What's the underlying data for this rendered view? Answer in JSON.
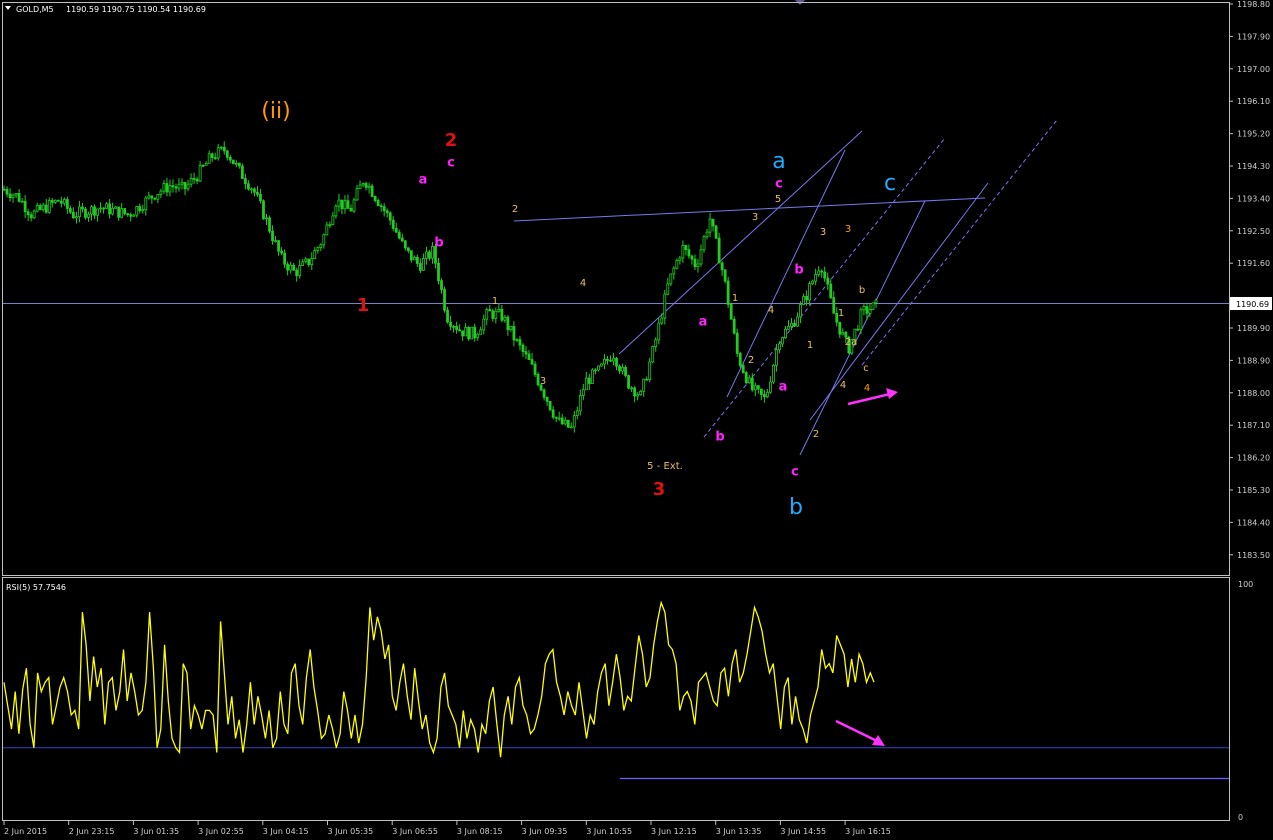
{
  "header": {
    "symbol": "GOLD,M5",
    "ohlc": "1190.59 1190.75 1190.54 1190.69",
    "rsi_label": "RSI(5) 57.7546"
  },
  "colors": {
    "background": "#000000",
    "grid_border": "#c0c0c0",
    "candle": "#22cc22",
    "trendline": "#7777ee",
    "rsi_line": "#ffff00",
    "arrow": "#ff33ff"
  },
  "price_axis": {
    "labels": [
      "1198.80",
      "1197.90",
      "1197.00",
      "1196.10",
      "1195.20",
      "1194.30",
      "1193.40",
      "1192.50",
      "1191.60",
      "1190.69",
      "1189.90",
      "1188.90",
      "1188.00",
      "1187.10",
      "1186.20",
      "1185.30",
      "1184.40",
      "1183.50"
    ],
    "current": "1190.69"
  },
  "rsi_axis": {
    "top": "100",
    "bottom": "0",
    "level": 30
  },
  "time_axis": [
    "2 Jun 2015",
    "2 Jun 23:15",
    "3 Jun 01:35",
    "3 Jun 02:55",
    "3 Jun 04:15",
    "3 Jun 05:35",
    "3 Jun 06:55",
    "3 Jun 08:15",
    "3 Jun 09:35",
    "3 Jun 10:55",
    "3 Jun 12:15",
    "3 Jun 13:35",
    "3 Jun 14:55",
    "3 Jun 16:15"
  ],
  "wave_labels": [
    {
      "text": "(ii)",
      "color": "#ff9900",
      "size": "xl"
    },
    {
      "text": "1",
      "color": "#dd1111",
      "size": "l"
    },
    {
      "text": "2",
      "color": "#dd1111",
      "size": "l"
    },
    {
      "text": "a",
      "color": "#ff22ff",
      "size": "s"
    },
    {
      "text": "b",
      "color": "#ff22ff",
      "size": "s"
    },
    {
      "text": "c",
      "color": "#ff22ff",
      "size": "s"
    },
    {
      "text": "2",
      "color": "#e8c060",
      "size": "xs"
    },
    {
      "text": "1",
      "color": "#e8c060",
      "size": "xs"
    },
    {
      "text": "3",
      "color": "#e8c060",
      "size": "xs"
    },
    {
      "text": "4",
      "color": "#e8c060",
      "size": "xs"
    },
    {
      "text": "5 - Ext.",
      "color": "#e8c060",
      "size": "xs"
    },
    {
      "text": "3",
      "color": "#dd1111",
      "size": "l"
    },
    {
      "text": "a",
      "color": "#ff22ff",
      "size": "s"
    },
    {
      "text": "b",
      "color": "#ff22ff",
      "size": "s"
    },
    {
      "text": "1",
      "color": "#e8c060",
      "size": "xs"
    },
    {
      "text": "2",
      "color": "#e8c060",
      "size": "xs"
    },
    {
      "text": "3",
      "color": "#e8c060",
      "size": "xs"
    },
    {
      "text": "4",
      "color": "#e8c060",
      "size": "xs"
    },
    {
      "text": "5",
      "color": "#e8c060",
      "size": "xs"
    },
    {
      "text": "c",
      "color": "#ff22ff",
      "size": "s"
    },
    {
      "text": "a",
      "color": "#22aaff",
      "size": "xl"
    },
    {
      "text": "b",
      "color": "#ff22ff",
      "size": "s"
    },
    {
      "text": "a",
      "color": "#ff22ff",
      "size": "s"
    },
    {
      "text": "c",
      "color": "#ff22ff",
      "size": "s"
    },
    {
      "text": "b",
      "color": "#22aaff",
      "size": "xl"
    },
    {
      "text": "1",
      "color": "#e8c060",
      "size": "xs"
    },
    {
      "text": "2",
      "color": "#e8c060",
      "size": "xs"
    },
    {
      "text": "3",
      "color": "#e8c060",
      "size": "xs"
    },
    {
      "text": "4",
      "color": "#e8c060",
      "size": "xs"
    },
    {
      "text": "3",
      "color": "#ff9900",
      "size": "xs"
    },
    {
      "text": "1",
      "color": "#e8c060",
      "size": "xs"
    },
    {
      "text": "2a",
      "color": "#e8c060",
      "size": "xs"
    },
    {
      "text": "b",
      "color": "#e8c060",
      "size": "xs"
    },
    {
      "text": "c",
      "color": "#e8c060",
      "size": "xs"
    },
    {
      "text": "4",
      "color": "#ff9900",
      "size": "xs"
    },
    {
      "text": "c",
      "color": "#22aaff",
      "size": "xl"
    }
  ],
  "chart_data": [
    {
      "type": "candlestick",
      "title": "GOLD,M5",
      "ylim": [
        1183.3,
        1199.0
      ],
      "x": [
        "2 Jun 2015",
        "2 Jun 23:15",
        "3 Jun 01:35",
        "3 Jun 02:55",
        "3 Jun 04:15",
        "3 Jun 05:35",
        "3 Jun 06:55",
        "3 Jun 08:15",
        "3 Jun 09:35",
        "3 Jun 10:55",
        "3 Jun 12:15",
        "3 Jun 13:35",
        "3 Jun 14:55",
        "3 Jun 16:15"
      ],
      "close_path": [
        1193.9,
        1193.7,
        1193.2,
        1193.4,
        1193.6,
        1193.2,
        1193.3,
        1193.4,
        1193.3,
        1193.2,
        1193.5,
        1193.8,
        1194.0,
        1193.9,
        1194.3,
        1194.8,
        1195.0,
        1194.4,
        1193.9,
        1193.0,
        1192.0,
        1191.6,
        1191.9,
        1192.5,
        1193.6,
        1193.3,
        1194.2,
        1193.6,
        1193.0,
        1192.2,
        1191.8,
        1192.2,
        1190.4,
        1190.0,
        1189.9,
        1190.5,
        1190.4,
        1189.7,
        1189.1,
        1188.3,
        1187.5,
        1187.3,
        1188.6,
        1188.9,
        1189.4,
        1188.6,
        1188.2,
        1189.6,
        1191.3,
        1192.3,
        1191.8,
        1193.1,
        1191.5,
        1189.3,
        1188.4,
        1188.1,
        1189.8,
        1190.2,
        1191.0,
        1191.9,
        1190.4,
        1189.5,
        1190.5,
        1190.69
      ],
      "current": 1190.69,
      "trendlines": [
        {
          "from": [
            514,
            221
          ],
          "to": [
            985,
            198
          ],
          "style": "solid"
        },
        {
          "from": [
            619,
            354
          ],
          "to": [
            862,
            131
          ],
          "style": "solid"
        },
        {
          "from": [
            704,
            437
          ],
          "to": [
            945,
            138
          ],
          "style": "dashed"
        },
        {
          "from": [
            727,
            397
          ],
          "to": [
            845,
            150
          ],
          "style": "solid"
        },
        {
          "from": [
            800,
            455
          ],
          "to": [
            925,
            201
          ],
          "style": "solid"
        },
        {
          "from": [
            810,
            420
          ],
          "to": [
            988,
            183
          ],
          "style": "solid"
        },
        {
          "from": [
            862,
            365
          ],
          "to": [
            1057,
            120
          ],
          "style": "dashed"
        }
      ]
    },
    {
      "type": "line",
      "title": "RSI(5) 57.7546",
      "ylim": [
        0,
        100
      ],
      "level": 30,
      "values": [
        58,
        48,
        38,
        54,
        36,
        55,
        64,
        40,
        30,
        62,
        54,
        58,
        60,
        40,
        48,
        56,
        60,
        54,
        44,
        46,
        38,
        88,
        74,
        50,
        69,
        56,
        64,
        40,
        58,
        60,
        46,
        54,
        72,
        50,
        62,
        54,
        44,
        46,
        58,
        88,
        64,
        30,
        38,
        74,
        50,
        34,
        30,
        28,
        66,
        62,
        38,
        48,
        44,
        38,
        46,
        46,
        44,
        28,
        84,
        62,
        40,
        52,
        34,
        42,
        28,
        40,
        58,
        40,
        52,
        44,
        34,
        46,
        30,
        34,
        54,
        40,
        36,
        62,
        66,
        48,
        40,
        60,
        72,
        56,
        46,
        34,
        36,
        44,
        38,
        30,
        36,
        54,
        46,
        34,
        44,
        32,
        40,
        60,
        90,
        76,
        86,
        80,
        68,
        74,
        52,
        46,
        58,
        66,
        52,
        42,
        64,
        50,
        38,
        44,
        32,
        28,
        34,
        56,
        62,
        48,
        44,
        40,
        30,
        46,
        34,
        42,
        38,
        28,
        40,
        36,
        50,
        56,
        40,
        26,
        44,
        52,
        40,
        56,
        60,
        48,
        44,
        36,
        38,
        44,
        52,
        66,
        70,
        72,
        58,
        52,
        44,
        54,
        48,
        44,
        58,
        46,
        34,
        44,
        40,
        54,
        62,
        66,
        48,
        58,
        70,
        60,
        46,
        52,
        50,
        64,
        78,
        70,
        56,
        60,
        74,
        84,
        92,
        88,
        74,
        72,
        66,
        46,
        52,
        54,
        50,
        40,
        58,
        60,
        62,
        56,
        50,
        48,
        62,
        64,
        52,
        66,
        72,
        58,
        62,
        70,
        80,
        90,
        86,
        80,
        70,
        62,
        66,
        52,
        38,
        56,
        60,
        40,
        52,
        42,
        38,
        32,
        44,
        50,
        56,
        72,
        64,
        66,
        62,
        78,
        74,
        70,
        56,
        68,
        58,
        70,
        66,
        58,
        62,
        58
      ],
      "current": 57.7546
    }
  ]
}
